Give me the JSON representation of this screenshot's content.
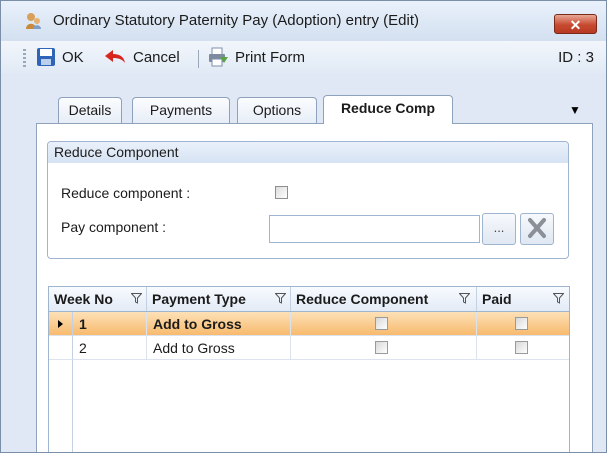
{
  "window": {
    "title": "Ordinary Statutory Paternity Pay (Adoption) entry (Edit)",
    "close_label": "✕"
  },
  "toolbar": {
    "ok_label": "OK",
    "cancel_label": "Cancel",
    "print_label": "Print Form",
    "id_label": "ID : 3"
  },
  "tabs": [
    {
      "label": "Details",
      "active": false
    },
    {
      "label": "Payments",
      "active": false
    },
    {
      "label": "Options",
      "active": false
    },
    {
      "label": "Reduce Comp",
      "active": true
    }
  ],
  "group": {
    "title": "Reduce Component",
    "reduce_label": "Reduce component :",
    "reduce_checked": false,
    "pay_component_label": "Pay component :",
    "pay_component_value": "",
    "lookup_label": "..."
  },
  "grid": {
    "columns": [
      "Week No",
      "Payment Type",
      "Reduce Component",
      "Paid"
    ],
    "rows": [
      {
        "week": "1",
        "payment_type": "Add to Gross",
        "reduce": false,
        "paid": false,
        "selected": true
      },
      {
        "week": "2",
        "payment_type": "Add to Gross",
        "reduce": false,
        "paid": false,
        "selected": false
      }
    ]
  },
  "colors": {
    "selected_row": "#f7b86a",
    "close_button": "#c74a30",
    "header_bg": "#dfe8f4"
  },
  "icons": [
    "app-icon",
    "save-icon",
    "undo-arrow-icon",
    "print-form-icon",
    "filter-icon",
    "clear-x-icon",
    "row-pointer-icon"
  ]
}
